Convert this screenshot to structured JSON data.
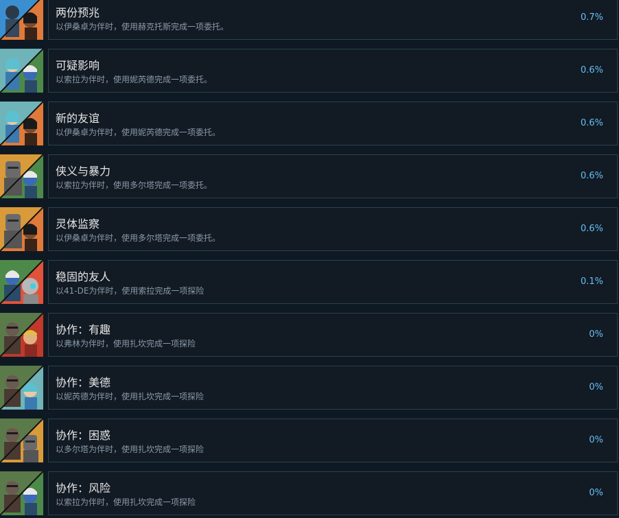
{
  "achievements": [
    {
      "title": "两份预兆",
      "description": "以伊桑卓为伴时，使用赫克托斯完成一项委托。",
      "percent": "0.7%",
      "icon": "achievement-portrait-icon",
      "colors": [
        "#3b8fd0",
        "#e07a3a"
      ]
    },
    {
      "title": "可疑影响",
      "description": "以索拉为伴时，使用妮芮德完成一项委托。",
      "percent": "0.6%",
      "icon": "achievement-portrait-icon",
      "colors": [
        "#6fb4b8",
        "#4d8a4a"
      ]
    },
    {
      "title": "新的友谊",
      "description": "以伊桑卓为伴时，使用妮芮德完成一项委托。",
      "percent": "0.6%",
      "icon": "achievement-portrait-icon",
      "colors": [
        "#6fb4b8",
        "#e07a3a"
      ]
    },
    {
      "title": "侠义与暴力",
      "description": "以索拉为伴时，使用多尔塔完成一项委托。",
      "percent": "0.6%",
      "icon": "achievement-portrait-icon",
      "colors": [
        "#d99a3a",
        "#4d8a4a"
      ]
    },
    {
      "title": "灵体监察",
      "description": "以伊桑卓为伴时，使用多尔塔完成一项委托。",
      "percent": "0.6%",
      "icon": "achievement-portrait-icon",
      "colors": [
        "#d99a3a",
        "#e07a3a"
      ]
    },
    {
      "title": "稳固的友人",
      "description": "以41-DE为伴时，使用索拉完成一项探险",
      "percent": "0.1%",
      "icon": "achievement-portrait-icon",
      "colors": [
        "#4d8a4a",
        "#e0523a"
      ]
    },
    {
      "title": "协作：有趣",
      "description": "以弗林为伴时，使用扎坎完成一项探险",
      "percent": "0%",
      "icon": "achievement-portrait-icon",
      "colors": [
        "#5a7a4a",
        "#c0392b"
      ]
    },
    {
      "title": "协作：美德",
      "description": "以妮芮德为伴时，使用扎坎完成一项探险",
      "percent": "0%",
      "icon": "achievement-portrait-icon",
      "colors": [
        "#5a7a4a",
        "#6fb4b8"
      ]
    },
    {
      "title": "协作：困惑",
      "description": "以多尔塔为伴时，使用扎坎完成一项探险",
      "percent": "0%",
      "icon": "achievement-portrait-icon",
      "colors": [
        "#5a7a4a",
        "#d99a3a"
      ]
    },
    {
      "title": "协作：风险",
      "description": "以索拉为伴时，使用扎坎完成一项探险",
      "percent": "0%",
      "icon": "achievement-portrait-icon",
      "colors": [
        "#5a7a4a",
        "#4d8a4a"
      ]
    }
  ]
}
